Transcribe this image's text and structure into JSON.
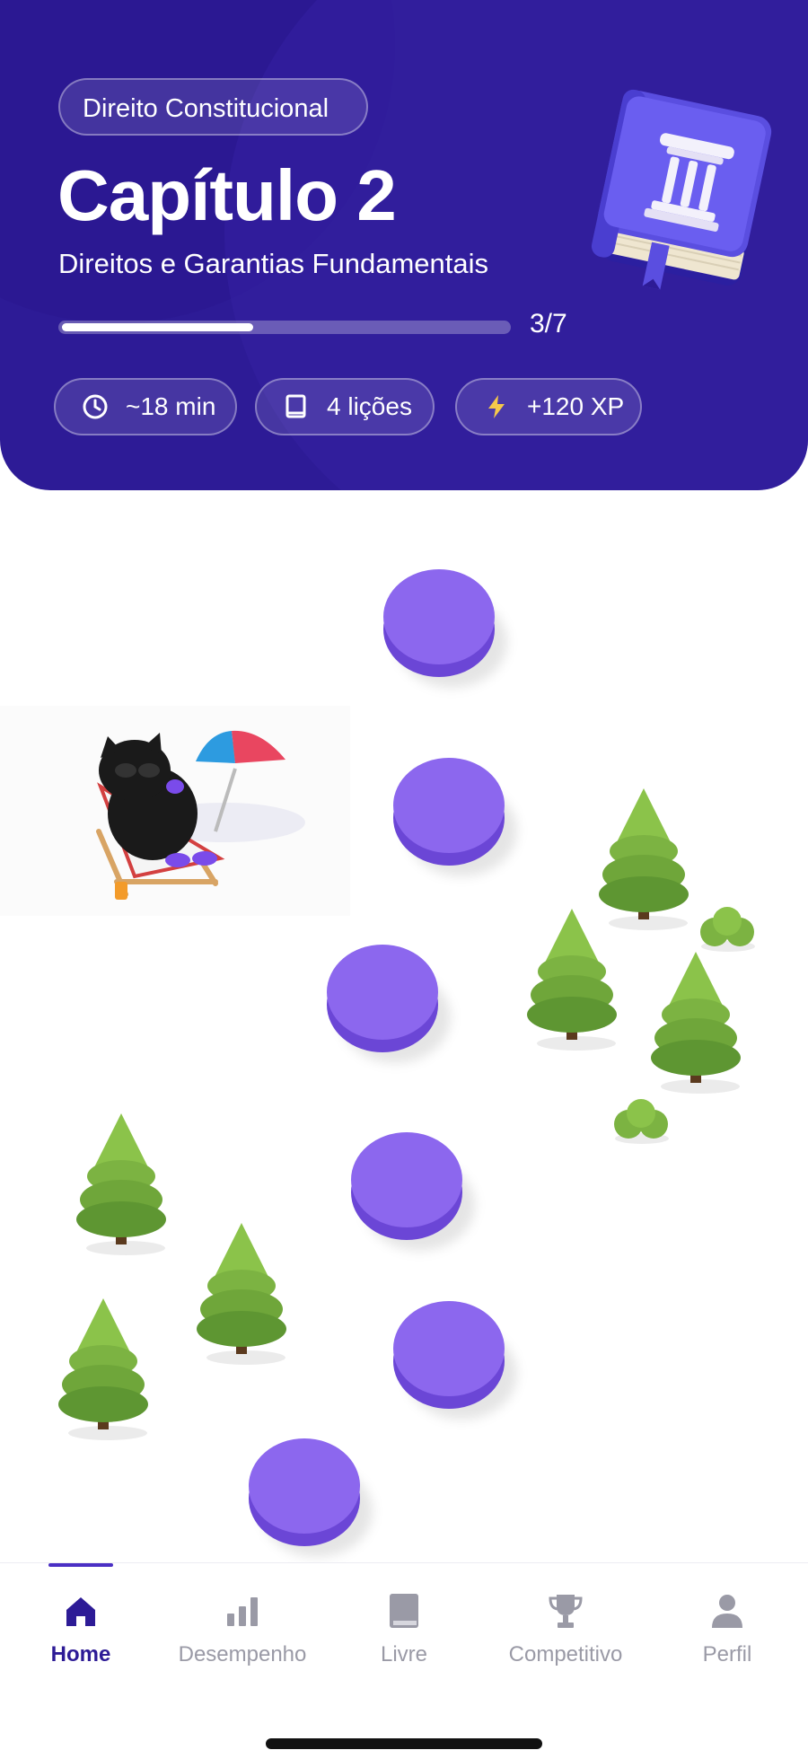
{
  "header": {
    "subject": "Direito Constitucional",
    "chapter_title": "Capítulo 2",
    "chapter_subtitle": "Direitos e Garantias Fundamentais",
    "progress": {
      "completed": 3,
      "total": 7,
      "label": "3/7"
    },
    "chips": [
      {
        "icon": "clock-icon",
        "label": "~18 min"
      },
      {
        "icon": "book-icon",
        "label": "4 lições"
      },
      {
        "icon": "lightning-icon",
        "label": "+120 XP"
      }
    ],
    "book_illustration": "column-book-illustration"
  },
  "path": {
    "lesson_node_count": 6,
    "mascot": "cat-beach-chair-illustration"
  },
  "tabbar": {
    "items": [
      {
        "label": "Home",
        "icon": "home-icon",
        "active": true
      },
      {
        "label": "Desempenho",
        "icon": "bar-chart-icon",
        "active": false
      },
      {
        "label": "Livre",
        "icon": "book-icon",
        "active": false
      },
      {
        "label": "Competitivo",
        "icon": "trophy-icon",
        "active": false
      },
      {
        "label": "Perfil",
        "icon": "person-icon",
        "active": false
      }
    ]
  },
  "colors": {
    "header_bg": "#2d1b96",
    "node": "#8c67ee",
    "tree": "#6fae3a",
    "active_tab": "#2d1b96",
    "inactive_tab": "#9a9aa6"
  }
}
